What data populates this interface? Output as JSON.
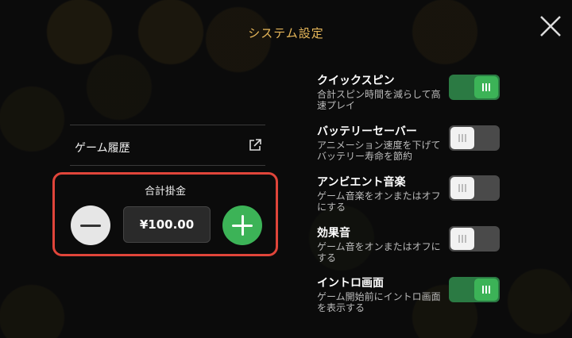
{
  "header": {
    "title": "システム設定"
  },
  "close": {
    "icon": "close-icon"
  },
  "history": {
    "label": "ゲーム履歴",
    "icon": "external-link-icon"
  },
  "bet": {
    "label": "合計掛金",
    "amount": "¥100.00",
    "minus_icon": "minus-icon",
    "plus_icon": "plus-icon"
  },
  "settings": [
    {
      "title": "クイックスピン",
      "desc": "合計スピン時間を減らして高速プレイ",
      "on": true
    },
    {
      "title": "バッテリーセーバー",
      "desc": "アニメーション速度を下げてバッテリー寿命を節約",
      "on": false
    },
    {
      "title": "アンビエント音楽",
      "desc": "ゲーム音楽をオンまたはオフにする",
      "on": false
    },
    {
      "title": "効果音",
      "desc": "ゲーム音をオンまたはオフにする",
      "on": false
    },
    {
      "title": "イントロ画面",
      "desc": "ゲーム開始前にイントロ画面を表示する",
      "on": true
    }
  ],
  "colors": {
    "accent_title": "#e8b85a",
    "toggle_on": "#3cb357",
    "highlight_border": "#e0453a"
  }
}
